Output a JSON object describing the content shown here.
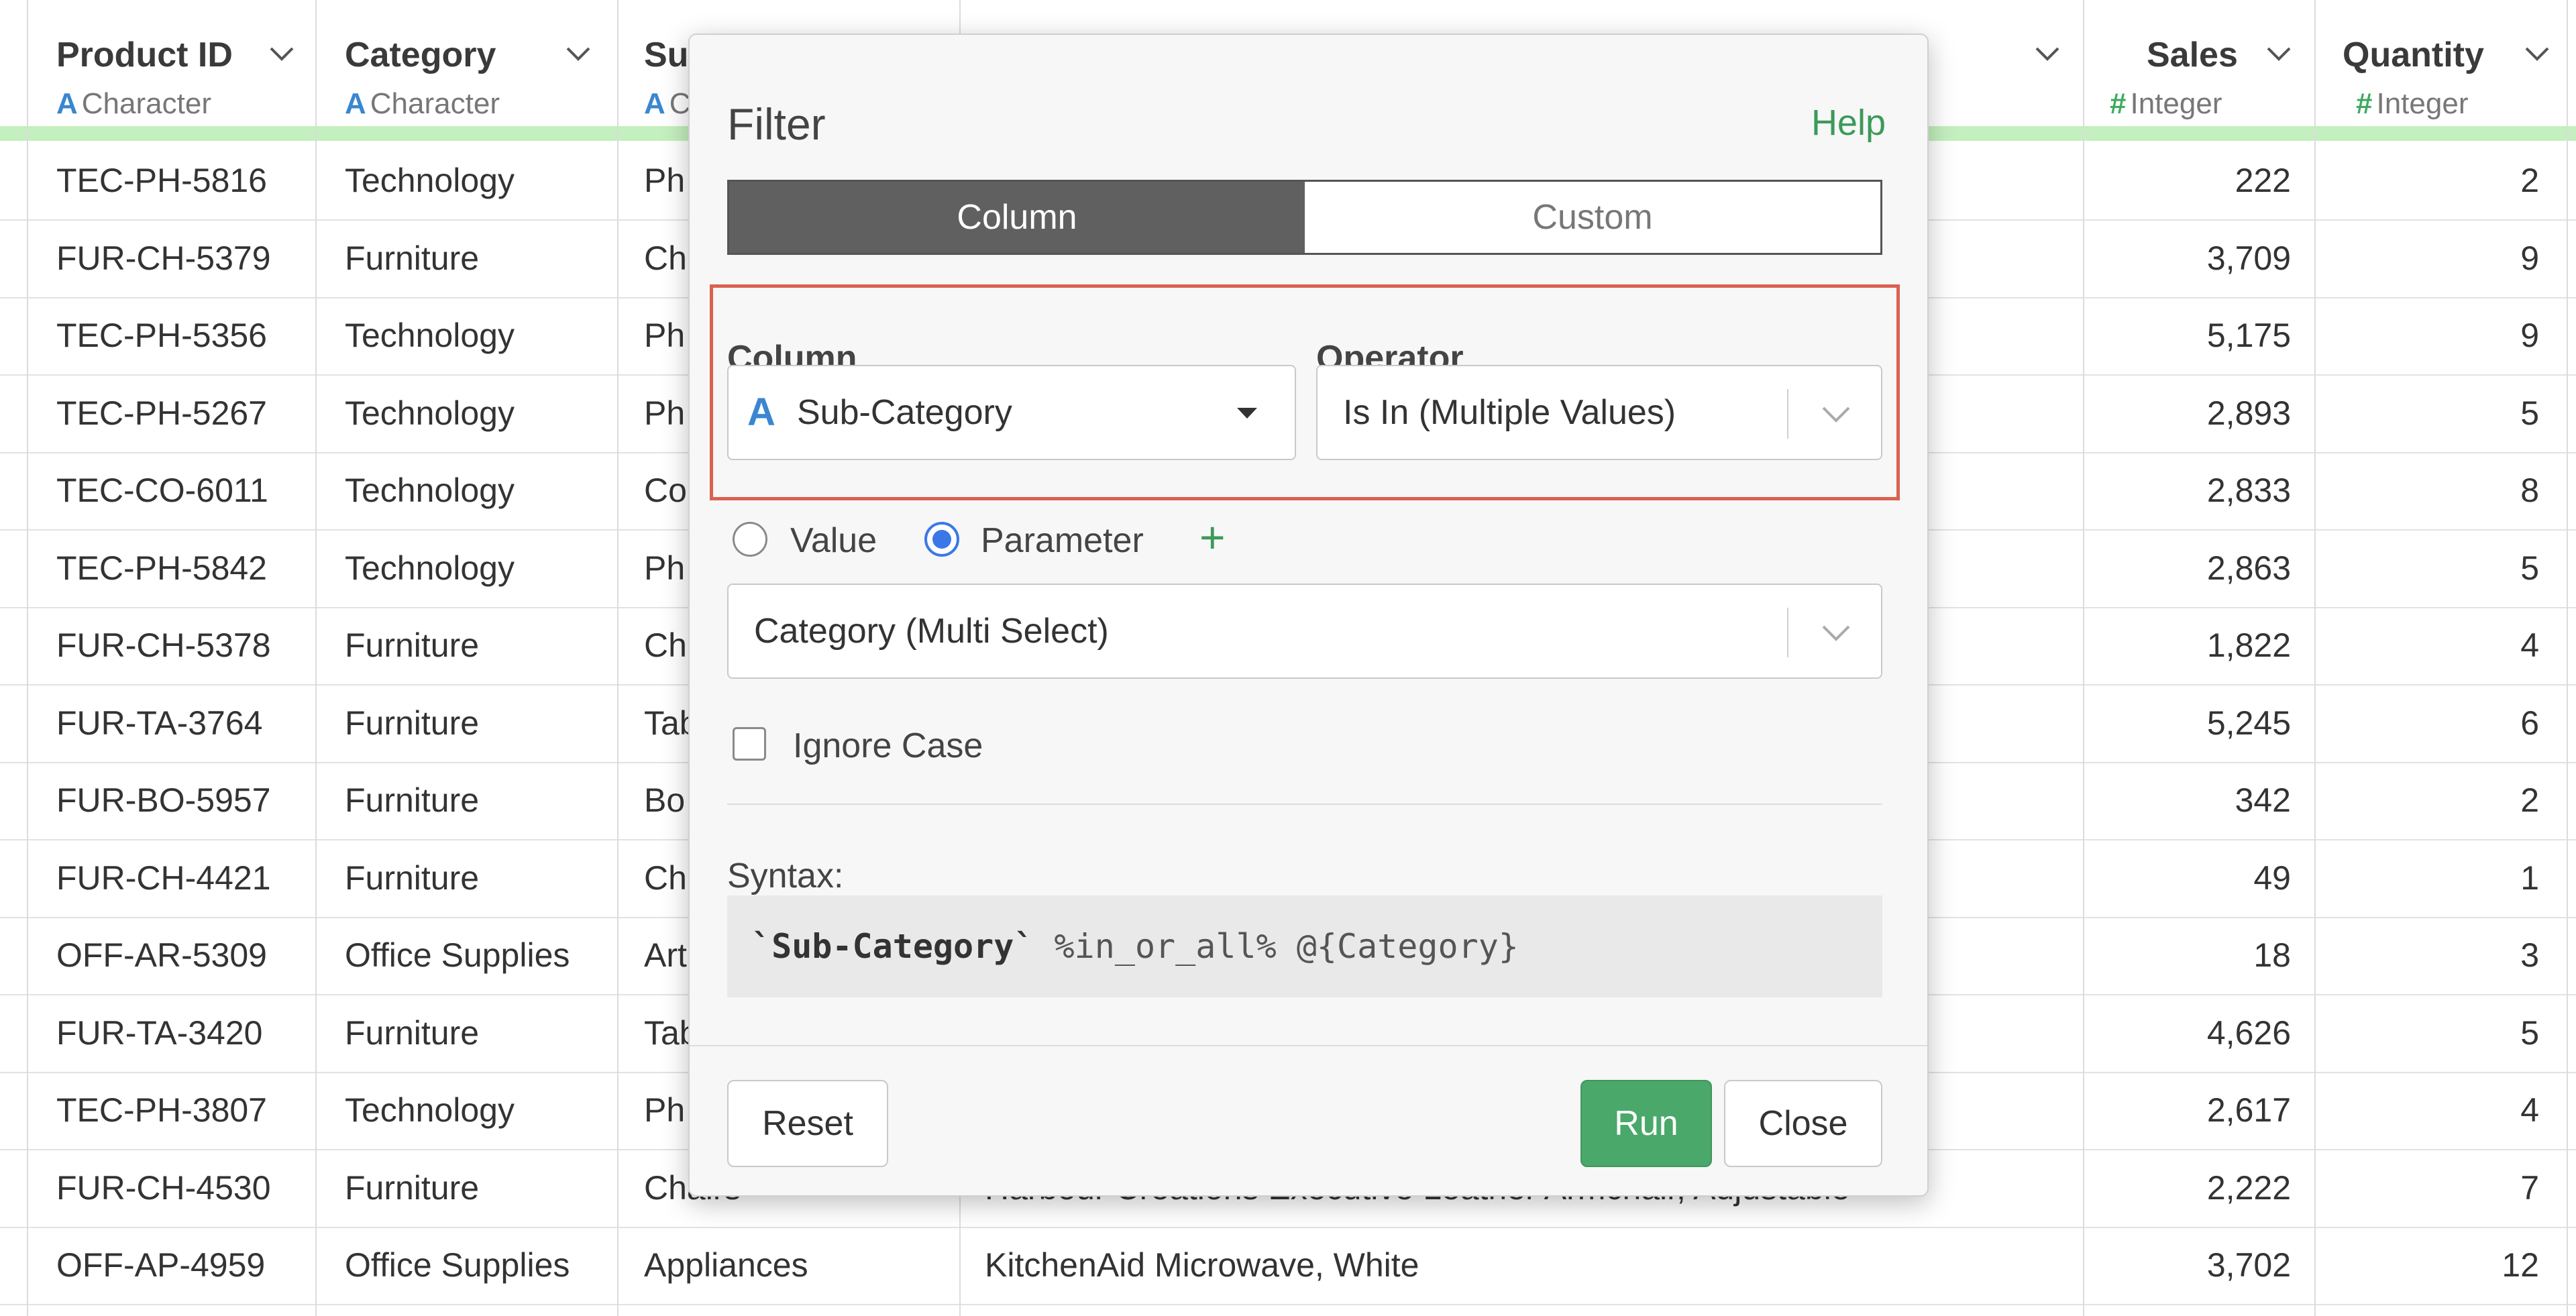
{
  "columns": {
    "product_id": {
      "name": "Product ID",
      "type": "Character",
      "type_icon": "A"
    },
    "category": {
      "name": "Category",
      "type": "Character",
      "type_icon": "A"
    },
    "sub_category_partial": {
      "name": "Su",
      "type_icon": "A",
      "type": "C"
    },
    "sales": {
      "name": "Sales",
      "type": "Integer",
      "type_icon": "#"
    },
    "quantity": {
      "name": "Quantity",
      "type": "Integer",
      "type_icon": "#"
    }
  },
  "rows": [
    {
      "product_id": "TEC-PH-5816",
      "category": "Technology",
      "sub": "Ph",
      "product": "",
      "sales": "222",
      "qty": "2"
    },
    {
      "product_id": "FUR-CH-5379",
      "category": "Furniture",
      "sub": "Ch",
      "product": "",
      "sales": "3,709",
      "qty": "9"
    },
    {
      "product_id": "TEC-PH-5356",
      "category": "Technology",
      "sub": "Ph",
      "product": "",
      "sales": "5,175",
      "qty": "9"
    },
    {
      "product_id": "TEC-PH-5267",
      "category": "Technology",
      "sub": "Ph",
      "product": "",
      "sales": "2,893",
      "qty": "5"
    },
    {
      "product_id": "TEC-CO-6011",
      "category": "Technology",
      "sub": "Co",
      "product": "",
      "sales": "2,833",
      "qty": "8"
    },
    {
      "product_id": "TEC-PH-5842",
      "category": "Technology",
      "sub": "Ph",
      "product": "",
      "sales": "2,863",
      "qty": "5"
    },
    {
      "product_id": "FUR-CH-5378",
      "category": "Furniture",
      "sub": "Ch",
      "product": "",
      "sales": "1,822",
      "qty": "4"
    },
    {
      "product_id": "FUR-TA-3764",
      "category": "Furniture",
      "sub": "Tab",
      "product": "",
      "sales": "5,245",
      "qty": "6"
    },
    {
      "product_id": "FUR-BO-5957",
      "category": "Furniture",
      "sub": "Bo",
      "product": "",
      "sales": "342",
      "qty": "2"
    },
    {
      "product_id": "FUR-CH-4421",
      "category": "Furniture",
      "sub": "Ch",
      "product": "",
      "sales": "49",
      "qty": "1"
    },
    {
      "product_id": "OFF-AR-5309",
      "category": "Office Supplies",
      "sub": "Art",
      "product": "",
      "sales": "18",
      "qty": "3"
    },
    {
      "product_id": "FUR-TA-3420",
      "category": "Furniture",
      "sub": "Tab",
      "product": "",
      "sales": "4,626",
      "qty": "5"
    },
    {
      "product_id": "TEC-PH-3807",
      "category": "Technology",
      "sub": "Ph",
      "product": "",
      "sales": "2,617",
      "qty": "4"
    },
    {
      "product_id": "FUR-CH-4530",
      "category": "Furniture",
      "sub": "Chairs",
      "product": "Harbour Creations Executive Leather Armchair, Adjustable",
      "sales": "2,222",
      "qty": "7"
    },
    {
      "product_id": "OFF-AP-4959",
      "category": "Office Supplies",
      "sub": "Appliances",
      "product": "KitchenAid Microwave, White",
      "sales": "3,702",
      "qty": "12"
    }
  ],
  "dialog": {
    "title": "Filter",
    "help": "Help",
    "tabs": {
      "column": "Column",
      "custom": "Custom"
    },
    "column_label": "Column",
    "operator_label": "Operator",
    "column_value": "Sub-Category",
    "column_type_icon": "A",
    "operator_value": "Is In (Multiple Values)",
    "value_option": "Value",
    "parameter_option": "Parameter",
    "add_icon": "+",
    "parameter_value": "Category (Multi Select)",
    "ignore_case": "Ignore Case",
    "syntax_label": "Syntax:",
    "syntax_col": "`Sub-Category`",
    "syntax_rest": " %in_or_all% @{Category}",
    "reset": "Reset",
    "run": "Run",
    "close": "Close"
  },
  "colors": {
    "accent_green": "#4aa86a",
    "highlight_red": "#d9614f",
    "radio_blue": "#3b78e7"
  }
}
